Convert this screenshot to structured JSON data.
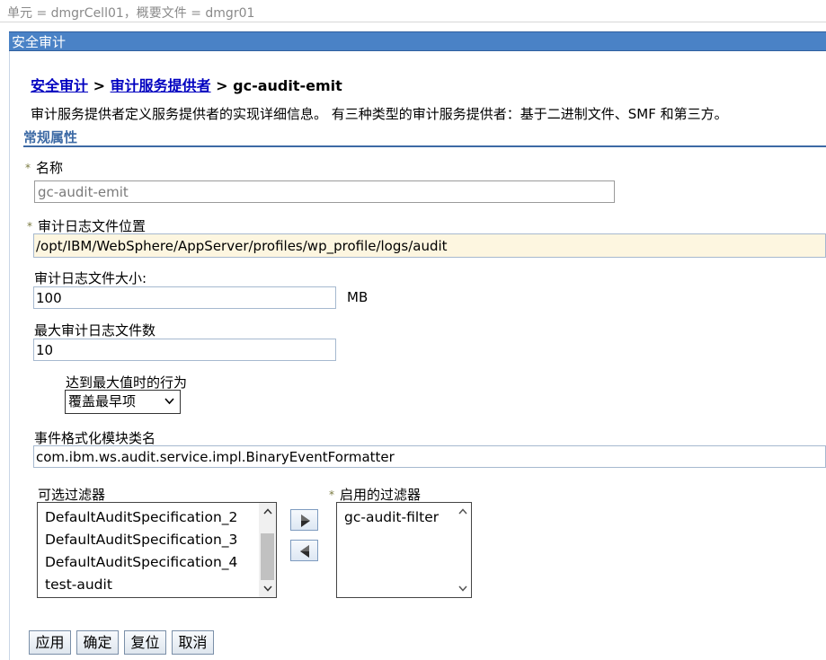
{
  "scope_text": "单元 = dmgrCell01，概要文件 = dmgr01",
  "panel_title": "安全审计",
  "breadcrumb": {
    "link1": "安全审计",
    "sep1": " > ",
    "link2": "审计服务提供者",
    "sep2": " > ",
    "current": "gc-audit-emit"
  },
  "description": "审计服务提供者定义服务提供者的实现详细信息。 有三种类型的审计服务提供者：基于二进制文件、SMF 和第三方。",
  "section_title": "常规属性",
  "required_marker": "*",
  "fields": {
    "name": {
      "label": "名称",
      "value": "gc-audit-emit"
    },
    "log_location": {
      "label": "审计日志文件位置",
      "value": "/opt/IBM/WebSphere/AppServer/profiles/wp_profile/logs/audit"
    },
    "log_size": {
      "label": "审计日志文件大小:",
      "value": "100",
      "unit": "MB"
    },
    "max_logs": {
      "label": "最大审计日志文件数",
      "value": "10"
    },
    "max_action": {
      "label": "达到最大值时的行为",
      "selected": "覆盖最早项"
    },
    "formatter": {
      "label": "事件格式化模块类名",
      "value": "com.ibm.ws.audit.service.impl.BinaryEventFormatter"
    }
  },
  "available_filters": {
    "label": "可选过滤器",
    "items": [
      "DefaultAuditSpecification_2",
      "DefaultAuditSpecification_3",
      "DefaultAuditSpecification_4",
      "test-audit"
    ]
  },
  "enabled_filters": {
    "label": "启用的过滤器",
    "items": [
      "gc-audit-filter"
    ]
  },
  "icons": {
    "add": "arrow-right-icon",
    "remove": "arrow-left-icon",
    "scroll_up": "chevron-up-icon",
    "scroll_down": "chevron-down-icon"
  },
  "buttons": {
    "apply": "应用",
    "ok": "确定",
    "reset": "复位",
    "cancel": "取消"
  },
  "colors": {
    "title_bar": "#4a82c6",
    "link": "#0000c0",
    "section": "#3d6aa5",
    "highlight_field": "#fdf6e0"
  }
}
